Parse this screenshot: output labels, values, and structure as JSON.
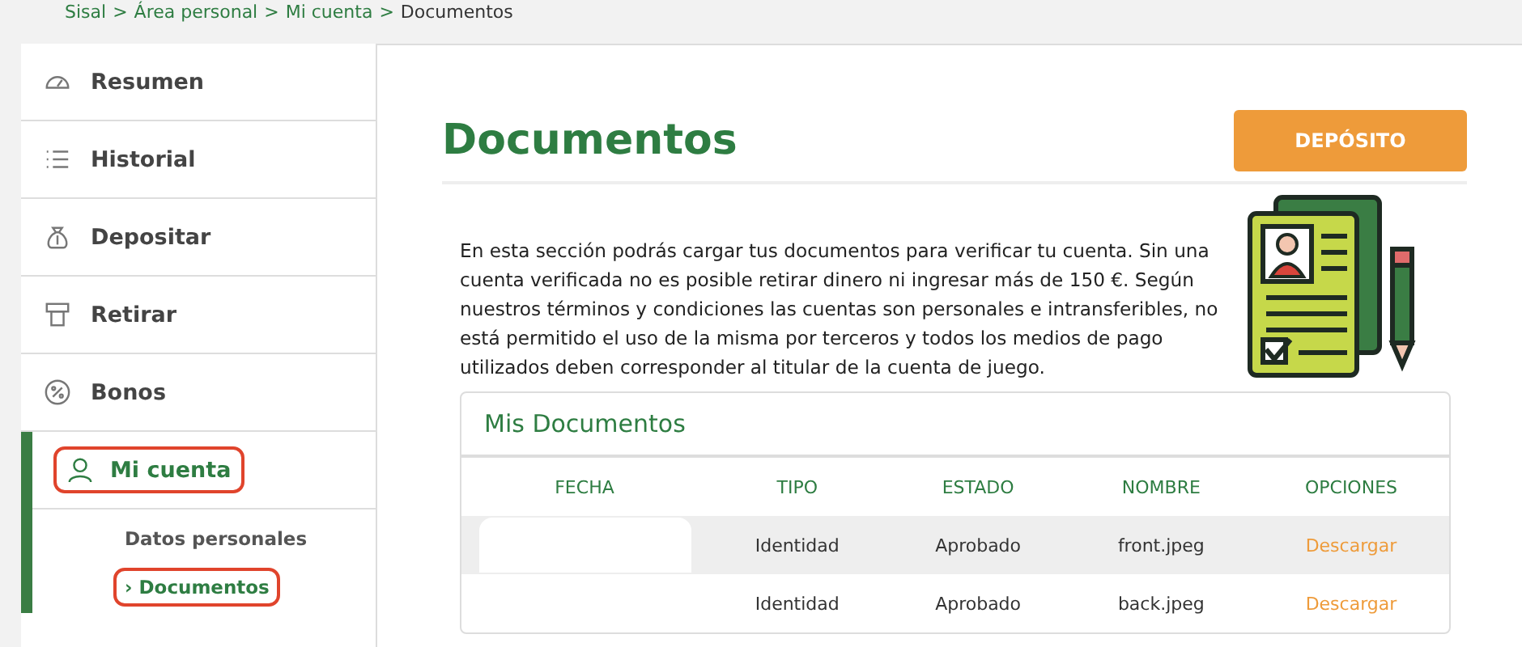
{
  "breadcrumb": [
    {
      "label": "Sisal"
    },
    {
      "label": "Área personal"
    },
    {
      "label": "Mi cuenta"
    },
    {
      "label": "Documentos"
    }
  ],
  "breadcrumb_separator": ">",
  "sidebar": {
    "items": [
      {
        "label": "Resumen",
        "selected": false,
        "annotated": false
      },
      {
        "label": "Historial",
        "selected": false,
        "annotated": false
      },
      {
        "label": "Depositar",
        "selected": false,
        "annotated": false
      },
      {
        "label": "Retirar",
        "selected": false,
        "annotated": false
      },
      {
        "label": "Bonos",
        "selected": false,
        "annotated": false
      },
      {
        "label": "Mi cuenta",
        "selected": true,
        "annotated": true,
        "children": [
          {
            "label": "Datos personales",
            "selected": false,
            "annotated": false
          },
          {
            "label": "Documentos",
            "selected": true,
            "annotated": true,
            "marker": "›"
          }
        ]
      }
    ]
  },
  "page": {
    "title": "Documentos",
    "button": "DEPÓSITO",
    "description": "En esta sección podrás cargar tus documentos para verificar tu cuenta. Sin una cuenta verificada no es posible retirar dinero ni ingresar más de 150 €. Según nuestros términos y condiciones las cuentas son personales e intransferibles, no está permitido el uso de la misma por terceros y todos los medios de pago utilizados deben corresponder al titular de la cuenta de juego."
  },
  "table": {
    "title": "Mis Documentos",
    "columns": [
      "FECHA",
      "TIPO",
      "ESTADO",
      "NOMBRE",
      "OPCIONES"
    ],
    "rows": [
      {
        "redacted": true,
        "cells": [
          "",
          "Identidad",
          "Aprobado",
          "front.jpeg",
          "Descargar"
        ]
      },
      {
        "redacted": false,
        "cells": [
          "",
          "Identidad",
          "Aprobado",
          "back.jpeg",
          "Descargar"
        ]
      }
    ]
  }
}
